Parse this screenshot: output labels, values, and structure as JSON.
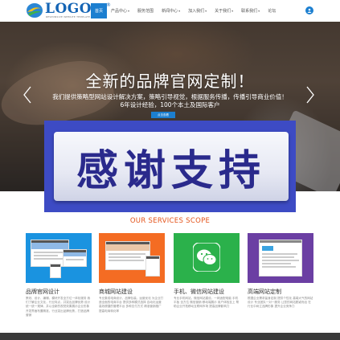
{
  "header": {
    "logo_text": "LOGO",
    "logo_sub": "RESPONSIVE WEBSITE TEMPLATE",
    "logo_reg": "®",
    "nav": [
      {
        "label": "首页",
        "active": true,
        "has_caret": false
      },
      {
        "label": "产品中心",
        "active": false,
        "has_caret": true
      },
      {
        "label": "服务范围",
        "active": false,
        "has_caret": false
      },
      {
        "label": "新闻中心",
        "active": false,
        "has_caret": true
      },
      {
        "label": "加入我们",
        "active": false,
        "has_caret": true
      },
      {
        "label": "关于我们",
        "active": false,
        "has_caret": true
      },
      {
        "label": "联系我们",
        "active": false,
        "has_caret": true
      },
      {
        "label": "论坛",
        "active": false,
        "has_caret": false
      }
    ],
    "caret_glyph": "▾",
    "user_icon": "user-icon"
  },
  "hero": {
    "title": "全新的品牌官网定制！",
    "desc_line1": "我们提供策略型网站设计解决方案，策略引导视觉，根据服务传播，传播引导商业价值！",
    "desc_line2": "6年设计经验，100个本土及国际客户",
    "button_label": "点击查看",
    "prev_icon": "chevron-left-icon",
    "next_icon": "chevron-right-icon"
  },
  "banner": {
    "text": "感谢支持"
  },
  "services": {
    "title": "OUR SERVICES SCOPE",
    "cards": [
      {
        "title": "品牌官网设计",
        "desc": "策划、设计、编辑、模块开发全方位一体化服务 我们了解企业文化，行业特点，并突出品牌优势 设计统一统一规律，并以全新的视觉效果展示企业形象 开发界面布置精准，行业突出品牌优势，打造品牌营销"
      },
      {
        "title": "商城网站建设",
        "desc": "专业集成电商设计，品牌包装，运营优化 为企业打造全面的电商平台 提供多种模式选择 自动化运营 高效便捷的管理平台 多种支付方式 精准营销推广 提高电商转化率"
      },
      {
        "title": "手机、微信网站建设",
        "desc": "专业手机网站、微信网站建设，一网适配电脑 手机 平板 全方位 微信营销 移动端展示 用户体验至上 帮助企业开拓移动互联网市场 提高品牌影响力"
      },
      {
        "title": "高端网站定制",
        "desc": "根据企业需求量身定制 提供个性化 高端大气的网站设计 专业团队一对一服务 让您的网站脱颖而出 在行业中树立品牌形象 提升企业竞争力"
      }
    ]
  },
  "colors": {
    "primary": "#1c7fd0",
    "services_title": "#e4531a",
    "banner_bg": "#3d4bc4",
    "banner_text": "#2a2a8c",
    "card1": "#1a93e0",
    "card2": "#f46c23",
    "card3": "#2bb14b",
    "card4": "#6b3fa3"
  }
}
